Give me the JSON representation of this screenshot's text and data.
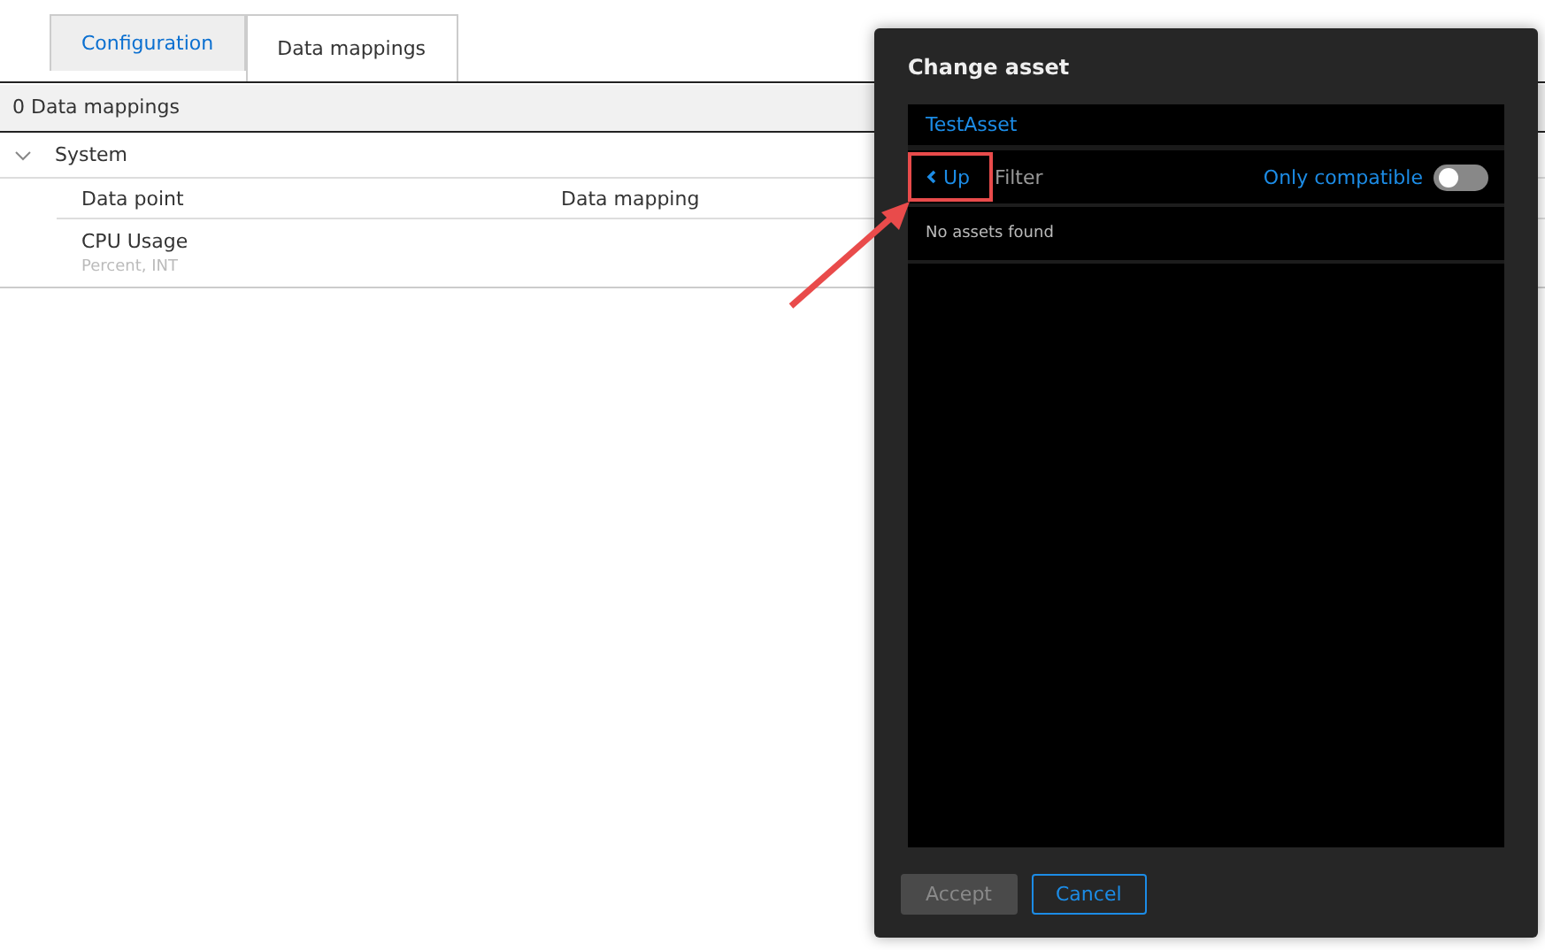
{
  "tabs": [
    {
      "label": "Configuration",
      "selected": false
    },
    {
      "label": "Data mappings",
      "selected": true
    }
  ],
  "summary": "0 Data mappings",
  "group": {
    "label": "System",
    "expanded": true
  },
  "columns": [
    "Data point",
    "Data mapping"
  ],
  "rows": [
    {
      "name": "CPU Usage",
      "type": "Percent, INT"
    }
  ],
  "dialog": {
    "title": "Change asset",
    "asset": "TestAsset",
    "up_label": "Up",
    "filter_placeholder": "Filter",
    "toggle": {
      "label": "Only compatible",
      "on": false
    },
    "empty_message": "No assets found",
    "buttons": [
      {
        "label": "Accept",
        "kind": "primary",
        "disabled": true
      },
      {
        "label": "Cancel",
        "kind": "secondary",
        "disabled": false
      }
    ]
  }
}
